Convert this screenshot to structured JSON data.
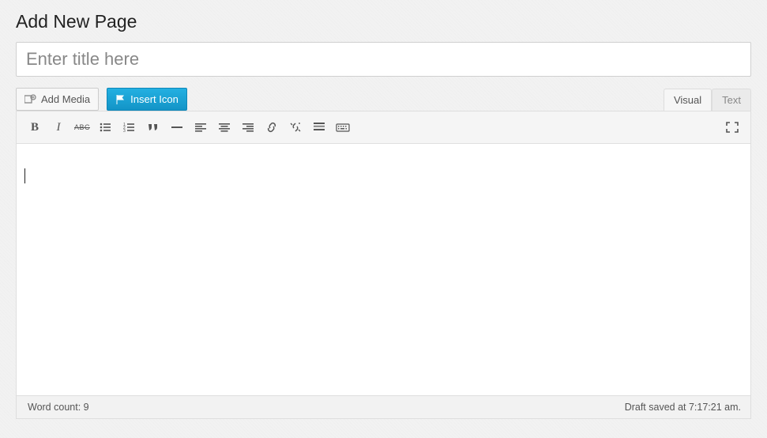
{
  "header": {
    "title": "Add New Page"
  },
  "title_field": {
    "placeholder": "Enter title here",
    "value": ""
  },
  "media_row": {
    "add_media_label": "Add Media",
    "insert_icon_label": "Insert Icon"
  },
  "tabs": {
    "visual": "Visual",
    "text": "Text",
    "active": "visual"
  },
  "toolbar": {
    "buttons": [
      {
        "name": "bold-button"
      },
      {
        "name": "italic-button"
      },
      {
        "name": "strikethrough-button"
      },
      {
        "name": "bulleted-list-button"
      },
      {
        "name": "numbered-list-button"
      },
      {
        "name": "blockquote-button"
      },
      {
        "name": "horizontal-rule-button"
      },
      {
        "name": "align-left-button"
      },
      {
        "name": "align-center-button"
      },
      {
        "name": "align-right-button"
      },
      {
        "name": "link-button"
      },
      {
        "name": "unlink-button"
      },
      {
        "name": "read-more-button"
      },
      {
        "name": "toolbar-toggle-button"
      }
    ],
    "fullscreen": {
      "name": "fullscreen-button"
    }
  },
  "editor": {
    "content": ""
  },
  "footer": {
    "word_count_label": "Word count: 9",
    "autosave_label": "Draft saved at 7:17:21 am."
  }
}
